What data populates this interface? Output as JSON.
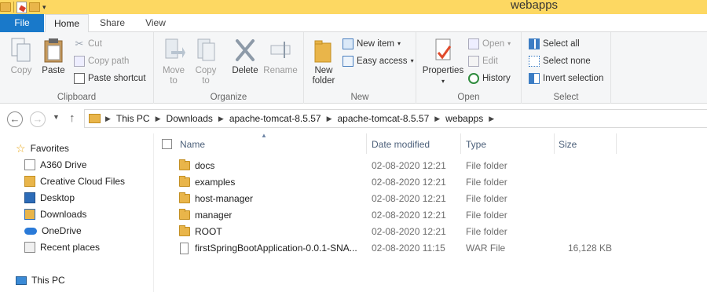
{
  "window": {
    "title": "webapps"
  },
  "ribbon_tabs": {
    "file": "File",
    "home": "Home",
    "share": "Share",
    "view": "View"
  },
  "clipboard": {
    "group_label": "Clipboard",
    "copy": "Copy",
    "paste": "Paste",
    "cut": "Cut",
    "copy_path": "Copy path",
    "paste_shortcut": "Paste shortcut"
  },
  "organize": {
    "group_label": "Organize",
    "move_to": "Move",
    "move_to_2": "to",
    "copy_to": "Copy",
    "copy_to_2": "to",
    "delete": "Delete",
    "rename": "Rename"
  },
  "new_group": {
    "group_label": "New",
    "new_folder": "New",
    "new_folder_2": "folder",
    "new_item": "New item",
    "easy_access": "Easy access"
  },
  "open_group": {
    "group_label": "Open",
    "properties": "Properties",
    "open": "Open",
    "edit": "Edit",
    "history": "History"
  },
  "select_group": {
    "group_label": "Select",
    "select_all": "Select all",
    "select_none": "Select none",
    "invert_selection": "Invert selection"
  },
  "address": {
    "crumbs": [
      "This PC",
      "Downloads",
      "apache-tomcat-8.5.57",
      "apache-tomcat-8.5.57",
      "webapps"
    ]
  },
  "nav_pane": {
    "favorites": "Favorites",
    "items": [
      "A360 Drive",
      "Creative Cloud Files",
      "Desktop",
      "Downloads",
      "OneDrive",
      "Recent places"
    ],
    "this_pc": "This PC"
  },
  "columns": {
    "name": "Name",
    "date": "Date modified",
    "type": "Type",
    "size": "Size"
  },
  "files": [
    {
      "name": "docs",
      "date": "02-08-2020 12:21",
      "type": "File folder",
      "size": ""
    },
    {
      "name": "examples",
      "date": "02-08-2020 12:21",
      "type": "File folder",
      "size": ""
    },
    {
      "name": "host-manager",
      "date": "02-08-2020 12:21",
      "type": "File folder",
      "size": ""
    },
    {
      "name": "manager",
      "date": "02-08-2020 12:21",
      "type": "File folder",
      "size": ""
    },
    {
      "name": "ROOT",
      "date": "02-08-2020 12:21",
      "type": "File folder",
      "size": ""
    },
    {
      "name": "firstSpringBootApplication-0.0.1-SNA...",
      "date": "02-08-2020 11:15",
      "type": "WAR File",
      "size": "16,128 KB"
    }
  ]
}
